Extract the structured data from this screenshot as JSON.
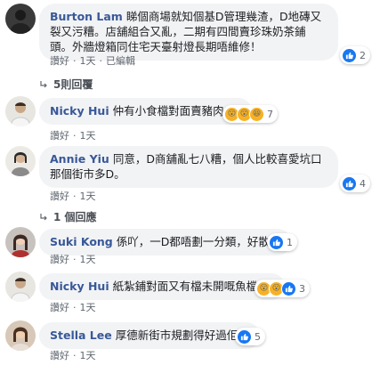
{
  "comments": [
    {
      "author": "Burton Lam",
      "text": "睇個商場就知個基D管理幾渣，D地磚又裂又污糟。店舖組合又亂，二期有四間賣珍珠奶茶鋪頭。外牆燈箱同住宅天臺射燈長期唔維修！",
      "actions": {
        "like": "讚好",
        "time": "1天",
        "edited": "已編輯"
      },
      "reaction_count": "2"
    },
    {
      "author": "Nicky Hui",
      "text": "仲有小食檔對面賣豬肉",
      "actions": {
        "like": "讚好",
        "time": "1天"
      },
      "reaction_count": "7"
    },
    {
      "author": "Annie Yiu",
      "text": "同意，D商舖亂七八糟，個人比較喜愛坑口那個街市多D。",
      "actions": {
        "like": "讚好",
        "time": "1天"
      },
      "reaction_count": "4"
    },
    {
      "author": "Suki Kong",
      "text": "係吖，一D都唔劃一分類，好散！",
      "actions": {
        "like": "讚好",
        "time": "1天"
      },
      "reaction_count": "1"
    },
    {
      "author": "Nicky Hui",
      "text": "紙紮鋪對面又有檔未開嘅魚檔",
      "actions": {
        "like": "讚好",
        "time": "1天"
      },
      "reaction_count": "3"
    },
    {
      "author": "Stella Lee",
      "text": "厚德新街市規劃得好過佢！",
      "actions": {
        "like": "讚好",
        "time": "1天"
      },
      "reaction_count": "5"
    }
  ],
  "reply_links": [
    {
      "label": "5則回覆"
    },
    {
      "label": "1 個回應"
    }
  ],
  "colors": {
    "author": "#385898",
    "bubble": "#f2f3f5",
    "like": "#1877f2",
    "wow": "#f7b125",
    "meta": "#606770"
  }
}
